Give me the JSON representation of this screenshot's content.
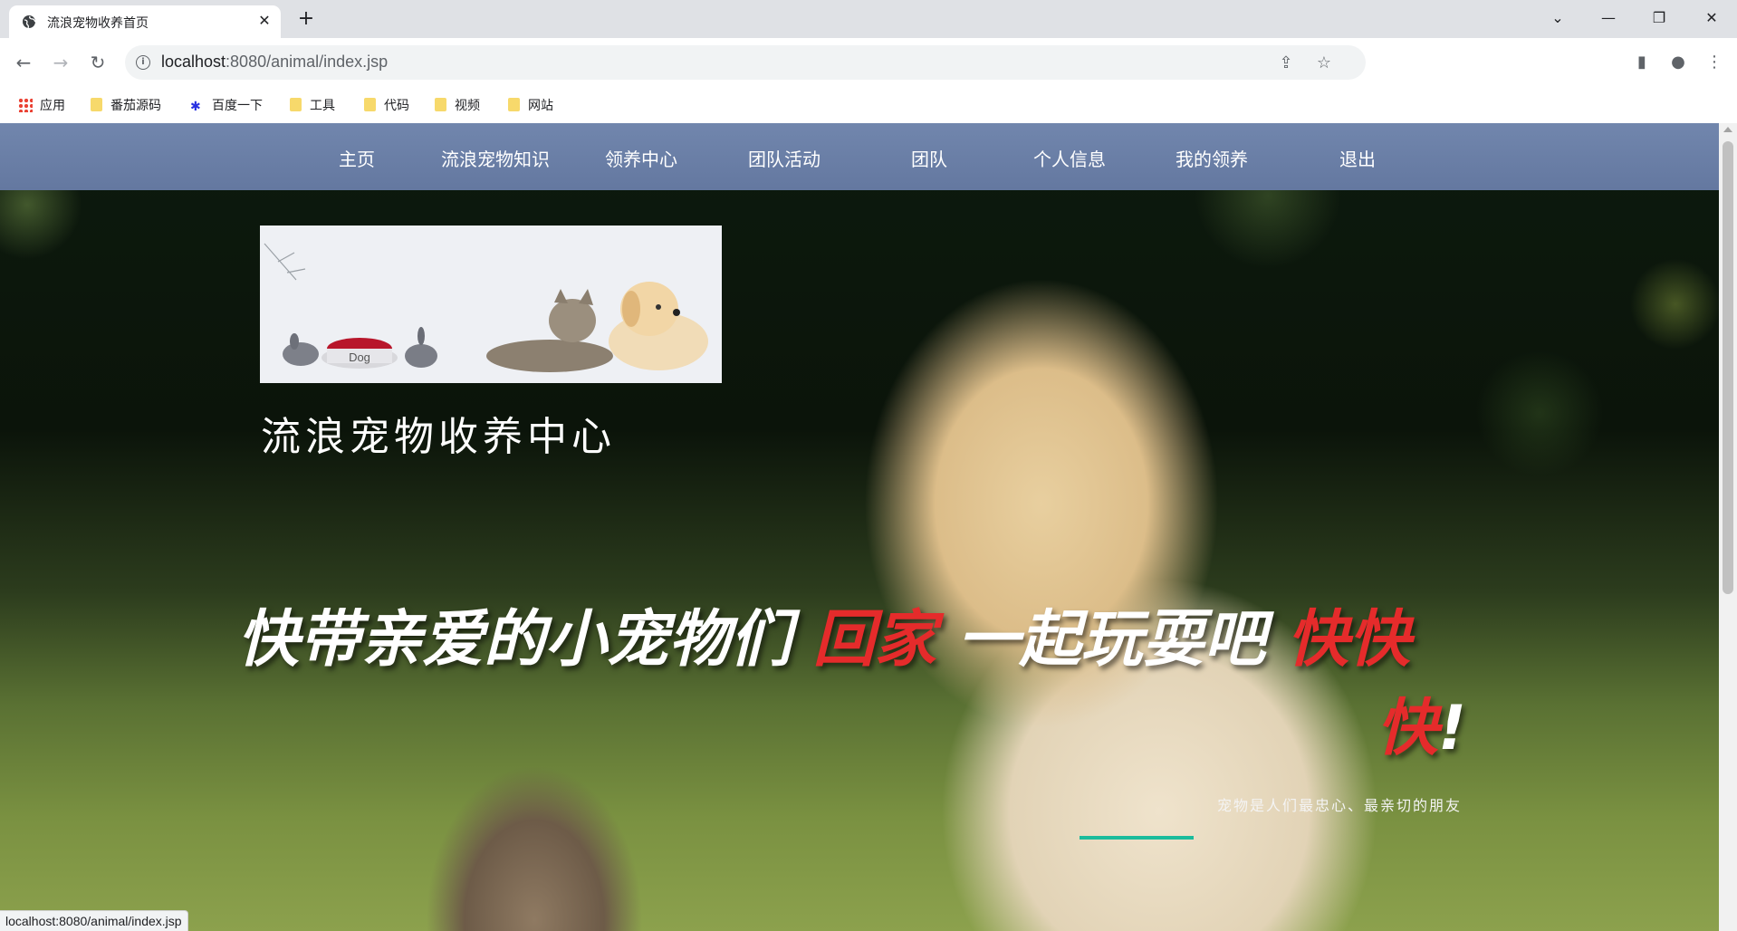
{
  "browser": {
    "tab_title": "流浪宠物收养首页",
    "url_host": "localhost",
    "url_rest": ":8080/animal/index.jsp",
    "status_url": "localhost:8080/animal/index.jsp",
    "bookmarks": [
      {
        "label": "应用",
        "icon": "apps-icon"
      },
      {
        "label": "番茄源码",
        "icon": "folder-icon"
      },
      {
        "label": "百度一下",
        "icon": "paw-icon"
      },
      {
        "label": "工具",
        "icon": "folder-icon"
      },
      {
        "label": "代码",
        "icon": "folder-icon"
      },
      {
        "label": "视频",
        "icon": "folder-icon"
      },
      {
        "label": "网站",
        "icon": "folder-icon"
      }
    ]
  },
  "nav": {
    "items": [
      "主页",
      "流浪宠物知识",
      "领养中心",
      "团队活动",
      "团队",
      "个人信息",
      "我的领养",
      "退出"
    ]
  },
  "hero": {
    "banner_label": "Dog",
    "site_title": "流浪宠物收养中心",
    "slogan_part1": "快带亲爱的小宠物们 ",
    "slogan_red1": "回家",
    "slogan_part2": " 一起玩耍吧 ",
    "slogan_red2a": "快快",
    "slogan_red2b": "快",
    "slogan_exclaim": "!",
    "subline": "宠物是人们最忠心、最亲切的朋友"
  },
  "colors": {
    "nav_bg": "#6a7ea6",
    "accent_red": "#e52b2b",
    "accent_teal": "#1abc9c"
  }
}
